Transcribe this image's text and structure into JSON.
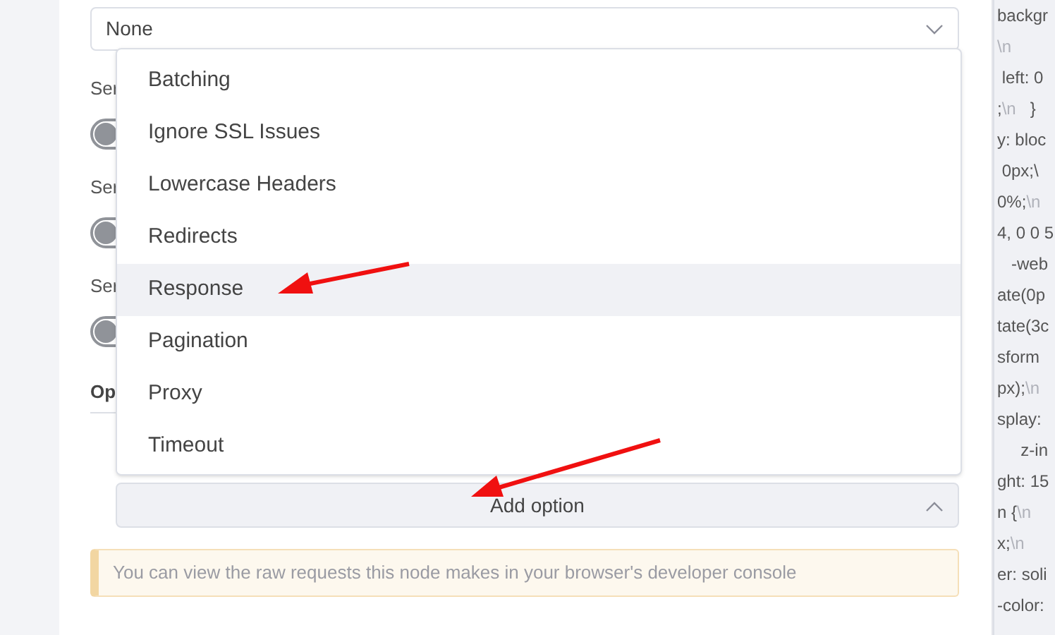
{
  "select": {
    "value": "None"
  },
  "settings": [
    {
      "label": "Ser",
      "on": false
    },
    {
      "label": "Ser",
      "on": false
    },
    {
      "label": "Ser",
      "on": false
    }
  ],
  "options_heading": "Op",
  "dropdown": {
    "items": [
      {
        "label": "Batching",
        "selected": false
      },
      {
        "label": "Ignore SSL Issues",
        "selected": false
      },
      {
        "label": "Lowercase Headers",
        "selected": false
      },
      {
        "label": "Redirects",
        "selected": false
      },
      {
        "label": "Response",
        "selected": true
      },
      {
        "label": "Pagination",
        "selected": false
      },
      {
        "label": "Proxy",
        "selected": false
      },
      {
        "label": "Timeout",
        "selected": false
      }
    ]
  },
  "add_option": {
    "label": "Add option",
    "expanded": true
  },
  "notice": "You can view the raw requests this node makes in your browser's developer console",
  "code_lines": [
    [
      {
        "text": "backgr",
        "kind": "code"
      }
    ],
    [
      {
        "text": "\\n",
        "kind": "escape"
      }
    ],
    [
      {
        "text": " left: 0",
        "kind": "code"
      }
    ],
    [
      {
        "text": ";",
        "kind": "code"
      },
      {
        "text": "\\n",
        "kind": "escape"
      },
      {
        "text": "   }",
        "kind": "code"
      }
    ],
    [
      {
        "text": "y: bloc",
        "kind": "code"
      }
    ],
    [
      {
        "text": " 0px;\\",
        "kind": "code"
      }
    ],
    [
      {
        "text": "0%;",
        "kind": "code"
      },
      {
        "text": "\\n",
        "kind": "escape"
      }
    ],
    [
      {
        "text": "4, 0 0 5",
        "kind": "code"
      }
    ],
    [
      {
        "text": "   -web",
        "kind": "code"
      }
    ],
    [
      {
        "text": "ate(0p",
        "kind": "code"
      }
    ],
    [
      {
        "text": "tate(3c",
        "kind": "code"
      }
    ],
    [
      {
        "text": "sform",
        "kind": "code"
      }
    ],
    [
      {
        "text": "px);",
        "kind": "code"
      },
      {
        "text": "\\n",
        "kind": "escape"
      }
    ],
    [
      {
        "text": "splay: ",
        "kind": "code"
      }
    ],
    [
      {
        "text": "     z-in",
        "kind": "code"
      }
    ],
    [
      {
        "text": "ght: 15",
        "kind": "code"
      }
    ],
    [
      {
        "text": "n {",
        "kind": "code"
      },
      {
        "text": "\\n",
        "kind": "escape"
      }
    ],
    [
      {
        "text": "x;",
        "kind": "code"
      },
      {
        "text": "\\n",
        "kind": "escape"
      }
    ],
    [
      {
        "text": "er: soli",
        "kind": "code"
      }
    ],
    [
      {
        "text": "-color:",
        "kind": "code"
      }
    ]
  ]
}
